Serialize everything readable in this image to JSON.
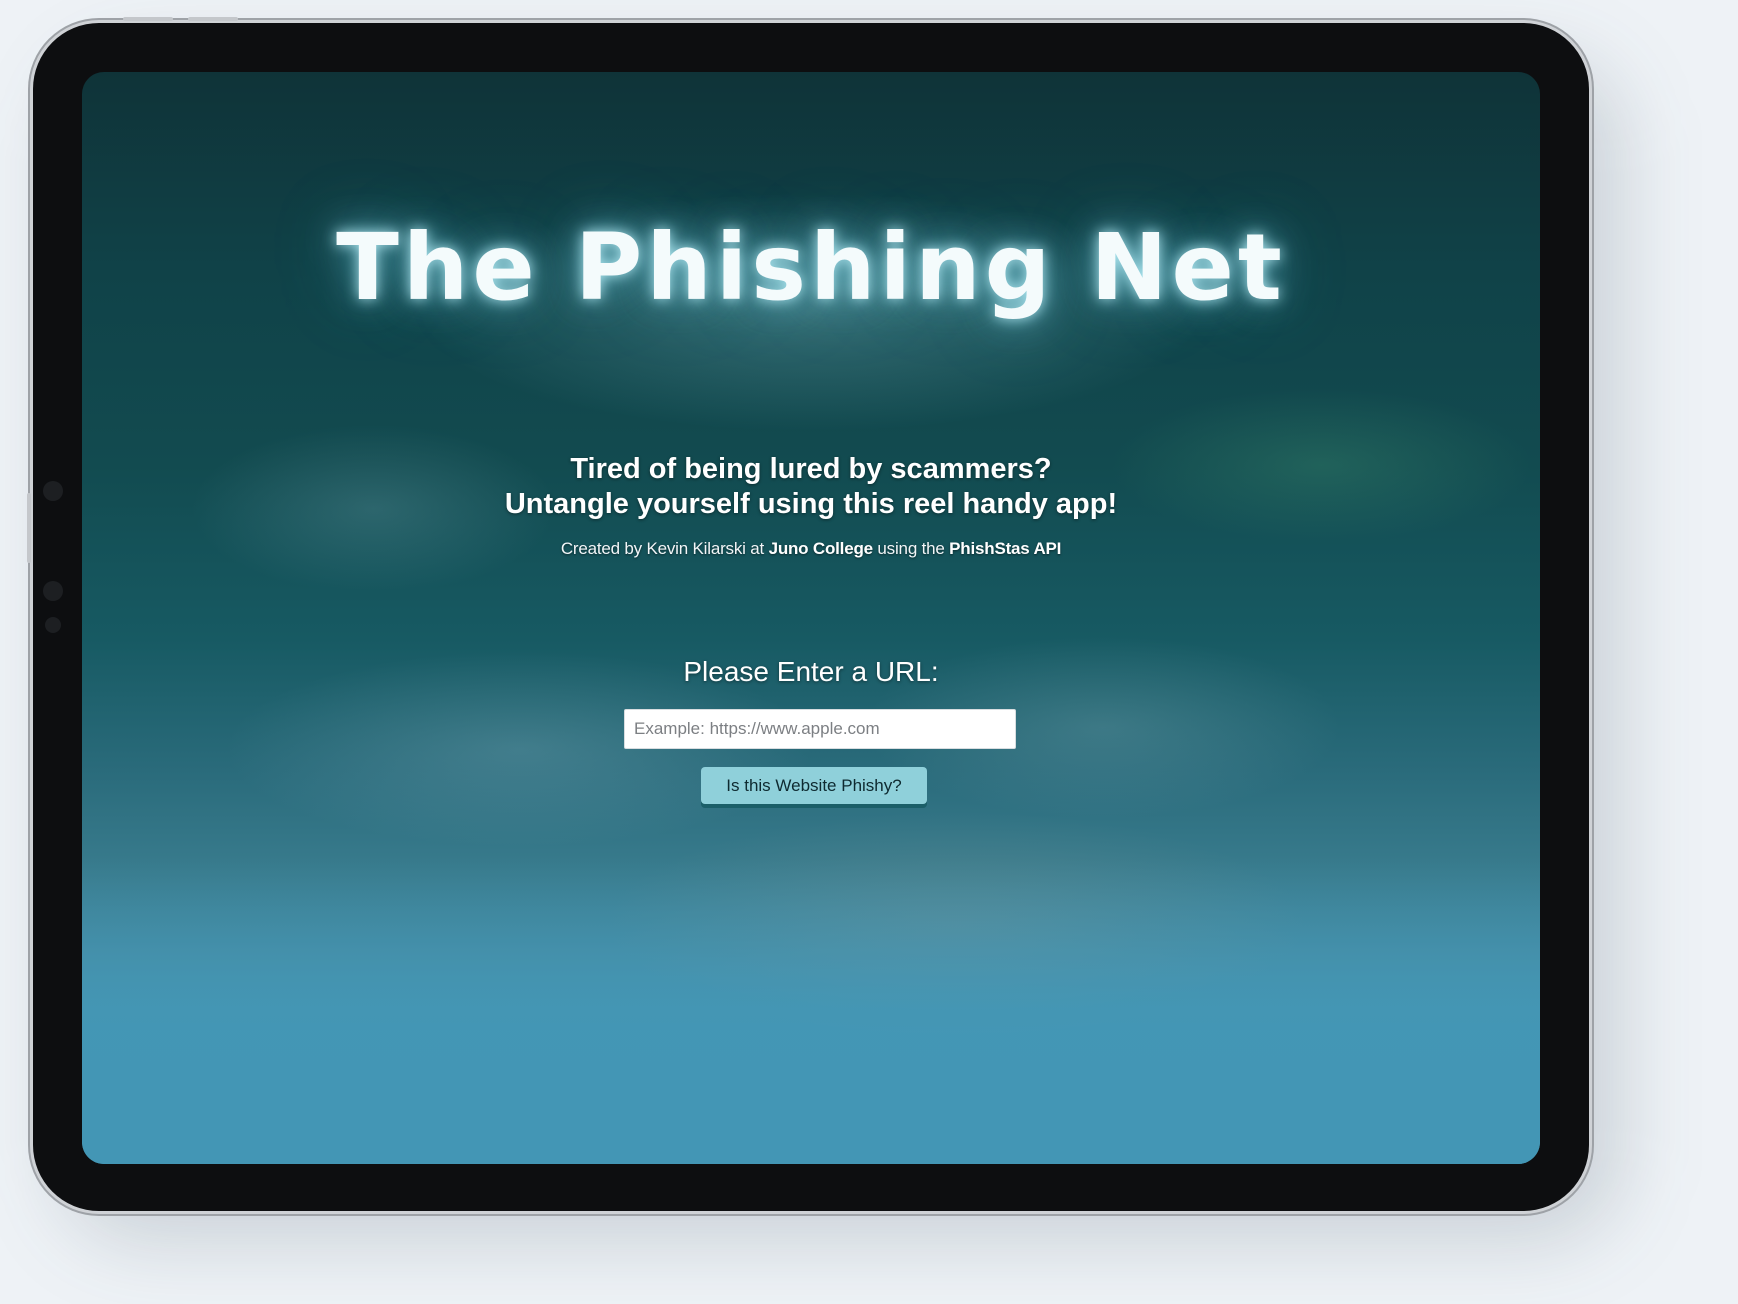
{
  "app": {
    "title": "The Phishing Net",
    "tagline_line1": "Tired of being lured by scammers?",
    "tagline_line2": "Untangle yourself using this reel handy app!",
    "credit": {
      "prefix": "Created by Kevin Kilarski at ",
      "school": "Juno College",
      "middle": " using the ",
      "api": "PhishStas API"
    }
  },
  "form": {
    "label": "Please Enter a URL:",
    "url_placeholder": "Example: https://www.apple.com",
    "url_value": "",
    "submit_label": "Is this Website Phishy?"
  },
  "colors": {
    "button_bg": "#8fd0da",
    "button_shadow": "#1b5f69",
    "ocean_bottom": "#4398b6",
    "ocean_top": "#0f3338"
  }
}
